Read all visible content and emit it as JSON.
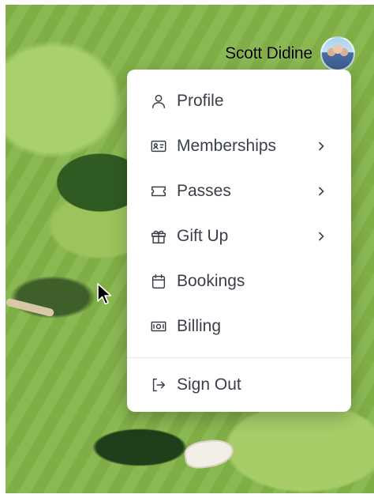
{
  "header": {
    "user_name": "Scott Didine",
    "avatar_icon": "user-avatar"
  },
  "menu": {
    "items": [
      {
        "label": "Profile",
        "icon": "user-icon",
        "has_submenu": false
      },
      {
        "label": "Memberships",
        "icon": "id-card-icon",
        "has_submenu": true
      },
      {
        "label": "Passes",
        "icon": "ticket-icon",
        "has_submenu": true
      },
      {
        "label": "Gift Up",
        "icon": "gift-icon",
        "has_submenu": true
      },
      {
        "label": "Bookings",
        "icon": "calendar-icon",
        "has_submenu": false
      },
      {
        "label": "Billing",
        "icon": "banknote-icon",
        "has_submenu": false
      }
    ],
    "sign_out": {
      "label": "Sign Out",
      "icon": "sign-out-icon"
    }
  },
  "colors": {
    "menu_text": "#3a3f4a",
    "menu_bg": "#ffffff",
    "divider": "#e5e7eb"
  }
}
